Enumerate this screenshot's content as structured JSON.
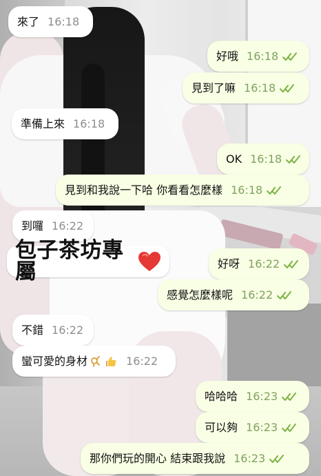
{
  "messages": {
    "left_1": {
      "text": "來了",
      "time": "16:18"
    },
    "right_1": {
      "text": "好哦",
      "time": "16:18"
    },
    "right_2": {
      "text": "見到了嘛",
      "time": "16:18"
    },
    "left_2": {
      "text": "準備上來",
      "time": "16:18"
    },
    "right_3": {
      "text": "OK",
      "time": "16:18"
    },
    "right_4": {
      "text": "見到和我說一下哈 你看看怎麼樣",
      "time": "16:18"
    },
    "left_3": {
      "text": "到囉",
      "time": "16:22"
    },
    "right_5": {
      "text": "好呀",
      "time": "16:22"
    },
    "right_6": {
      "text": "感覺怎麼樣呢",
      "time": "16:22"
    },
    "left_4": {
      "text": "不錯",
      "time": "16:22"
    },
    "left_5": {
      "text": "蠻可愛的身材",
      "time": "16:22"
    },
    "right_7": {
      "text": "哈哈哈",
      "time": "16:23"
    },
    "right_8": {
      "text": "可以夠",
      "time": "16:23"
    },
    "right_9": {
      "text": "那你們玩的開心 結束跟我說",
      "time": "16:23"
    }
  },
  "sticker": {
    "text": "包子茶坊專屬"
  },
  "icons": {
    "read_receipt": "double-check-icon",
    "heart": "red-heart-icon",
    "ok_hand": "ok-hand-icon",
    "thumbs_up": "thumbs-up-icon"
  },
  "colors": {
    "incoming_bubble": "#ffffff",
    "outgoing_bubble": "#f8ffe4",
    "outgoing_time": "#81a160",
    "incoming_time": "#8d8d8d",
    "read_receipt": "#7cb342"
  }
}
